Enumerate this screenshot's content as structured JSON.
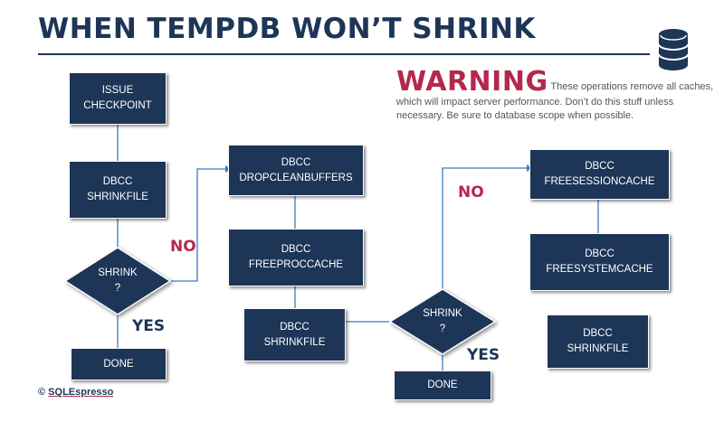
{
  "title": "WHEN TEMPDB WON’T SHRINK",
  "warning": {
    "heading": "WARNING",
    "text": "These operations remove all caches, which will impact server performance. Don’t do this stuff unless necessary. Be sure to database scope when possible."
  },
  "flow": {
    "issue_checkpoint": "ISSUE\nCHECKPOINT",
    "shrinkfile_1": "DBCC\nSHRINKFILE",
    "shrink_q_1": "SHRINK\n?",
    "done_1": "DONE",
    "no_1": "NO",
    "yes_1": "YES",
    "dropcleanbuffers": "DBCC\nDROPCLEANBUFFERS",
    "freeproccache": "DBCC\nFREEPROCCACHE",
    "shrinkfile_2": "DBCC\nSHRINKFILE",
    "shrink_q_2": "SHRINK\n?",
    "done_2": "DONE",
    "no_2": "NO",
    "yes_2": "YES",
    "freesessioncache": "DBCC\nFREESESSIONCACHE",
    "freesystemcache": "DBCC\nFREESYSTEMCACHE",
    "shrinkfile_3": "DBCC\nSHRINKFILE"
  },
  "footer": {
    "symbol": "©",
    "brand": "SQLEspresso"
  },
  "colors": {
    "navy": "#1d3557",
    "accent": "#b5284e",
    "connector": "#3a7bc8"
  },
  "icons": {
    "logo": "database-icon"
  }
}
